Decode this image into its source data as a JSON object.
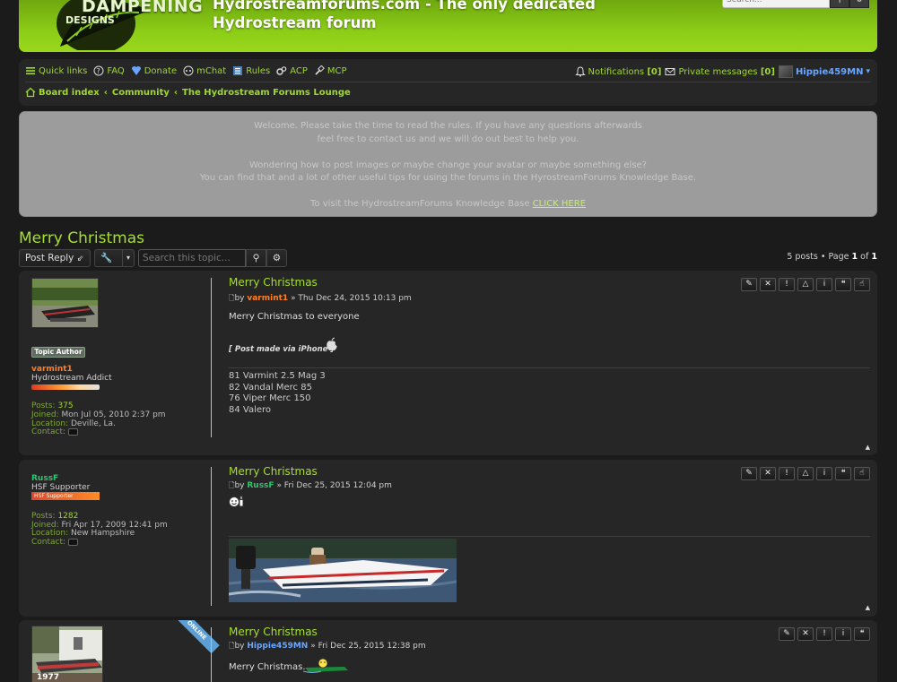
{
  "header": {
    "logo_text": "DAMPENING",
    "logo_sub": "DESIGNS",
    "site_title": "Hydrostreamforums.com - The only dedicated Hydrostream forum",
    "search_placeholder": "Search..."
  },
  "nav": {
    "quick_links": "Quick links",
    "faq": "FAQ",
    "donate": "Donate",
    "mchat": "mChat",
    "rules": "Rules",
    "acp": "ACP",
    "mcp": "MCP",
    "notifications_label": "Notifications",
    "notifications_count": "[0]",
    "pm_label": "Private messages",
    "pm_count": "[0]",
    "username": "Hippie459MN",
    "username_arrow": "▾"
  },
  "breadcrumbs": {
    "board": "Board index",
    "community": "Community",
    "forum": "The Hydrostream Forums Lounge",
    "sep": "‹"
  },
  "announcement": {
    "line1": "Welcome. Please take the time to read the rules. If you have any questions afterwards",
    "line2": "feel free to contact us and we will do out best to help you.",
    "line3": "Wondering how to post images or maybe change your avatar or maybe something else?",
    "line4": "You can find that and a lot of other useful tips for using the forums in the HyrostreamForums Knowledge Base.",
    "line5": "To visit the HydrostreamForums Knowledge Base",
    "link": "CLICK HERE"
  },
  "topic": {
    "title": "Merry Christmas",
    "post_reply": "Post Reply",
    "search_placeholder": "Search this topic...",
    "pagination_prefix": "5 posts • Page",
    "page_current": "1",
    "page_of": "of",
    "page_total": "1"
  },
  "posts": [
    {
      "author": "varmint1",
      "author_color": "#ff7f27",
      "badge": "Topic Author",
      "rank": "Hydrostream Addict",
      "posts_label": "Posts:",
      "posts": "375",
      "joined_label": "Joined:",
      "joined": "Mon Jul 05, 2010 2:37 pm",
      "location_label": "Location:",
      "location": "Deville, La.",
      "contact_label": "Contact:",
      "title": "Merry Christmas",
      "by": "by",
      "date": "» Thu Dec 24, 2015 10:13 pm",
      "text": "Merry Christmas to everyone",
      "via": "[ Post made via iPhone ]",
      "sig": [
        "81 Varmint 2.5 Mag 3",
        "82 Vandal Merc 85",
        "76 Viper Merc 150",
        "84 Valero"
      ]
    },
    {
      "author": "RussF",
      "author_color": "#2dc56f",
      "rank": "HSF Supporter",
      "rank_badge": "HSF Supporter",
      "posts_label": "Posts:",
      "posts": "1282",
      "joined_label": "Joined:",
      "joined": "Fri Apr 17, 2009 12:41 pm",
      "location_label": "Location:",
      "location": "New Hampshire",
      "contact_label": "Contact:",
      "title": "Merry Christmas",
      "by": "by",
      "date": "» Fri Dec 25, 2015 12:04 pm"
    },
    {
      "author": "Hippie459MN",
      "author_color": "#6aa6ff",
      "online": "ONLINE",
      "avatar_label": "1977",
      "title": "Merry Christmas",
      "by": "by",
      "date": "» Fri Dec 25, 2015 12:38 pm",
      "text": "Merry Christmas."
    }
  ],
  "post_buttons": [
    "✎",
    "✕",
    "!",
    "△",
    "i",
    "❝"
  ],
  "colors": {
    "accent_green": "#a6df2a",
    "header_green": "#8ccd17",
    "panel": "#262626",
    "background": "#1b1b1b"
  }
}
